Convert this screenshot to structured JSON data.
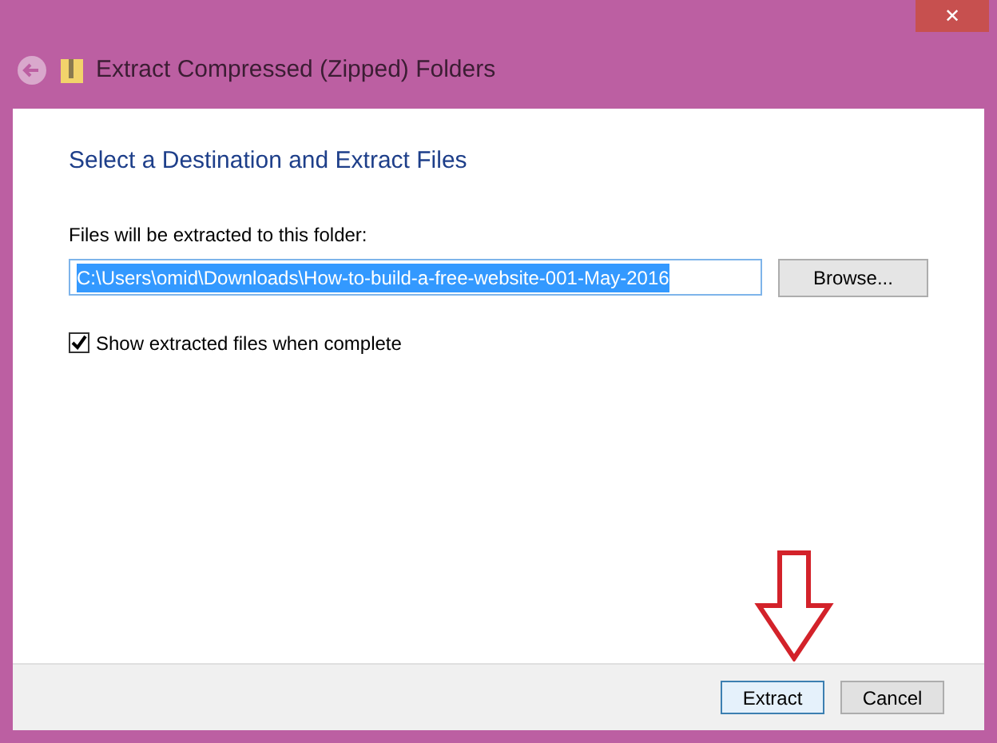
{
  "window": {
    "title": "Extract Compressed (Zipped) Folders",
    "close_label": "✕"
  },
  "heading": "Select a Destination and Extract Files",
  "folder_label": "Files will be extracted to this folder:",
  "folder_field": {
    "value": "C:\\Users\\omid\\Downloads\\How-to-build-a-free-website-001-May-2016",
    "selected": true
  },
  "browse_button": "Browse...",
  "show_files": {
    "label": "Show extracted files when complete",
    "checked": true
  },
  "buttons": [
    {
      "label": "Extract",
      "default": true
    },
    {
      "label": "Cancel",
      "default": false
    }
  ]
}
